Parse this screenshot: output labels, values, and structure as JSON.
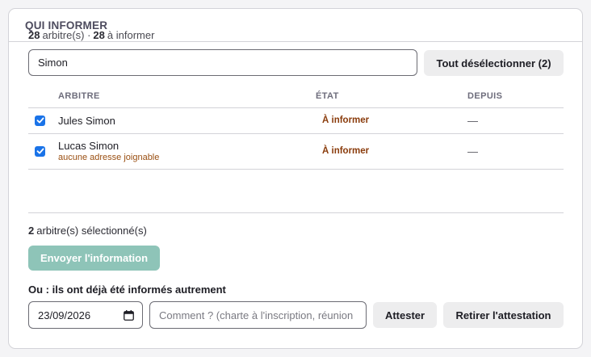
{
  "panel": {
    "title": "QUI INFORMER"
  },
  "counts": {
    "total": "28",
    "total_label": "arbitre(s) ·",
    "to_inform": "28",
    "to_inform_label": "à informer"
  },
  "search": {
    "value": "Simon",
    "deselect_label": "Tout désélectionner (2)"
  },
  "table": {
    "headers": [
      "ARBITRE",
      "ÉTAT",
      "DEPUIS"
    ],
    "rows": [
      {
        "checked": true,
        "name": "Jules Simon",
        "note": "",
        "state": "À informer",
        "since": "—"
      },
      {
        "checked": true,
        "name": "Lucas Simon",
        "note": "aucune adresse joignable",
        "state": "À informer",
        "since": "—"
      }
    ]
  },
  "selection": {
    "count": "2",
    "label": "arbitre(s) sélectionné(s)"
  },
  "send_label": "Envoyer l'information",
  "alternative": {
    "label": "Ou : ils ont déjà été informés autrement",
    "date": "23/09/2026",
    "comment_placeholder": "Comment ? (charte à l'inscription, réunion",
    "attest_label": "Attester",
    "remove_label": "Retirer l'attestation"
  },
  "colors": {
    "accent_send": "#8ec4b8",
    "state_text": "#8a3c0c",
    "checkbox": "#1a73e8"
  },
  "icons": [
    "checkbox-checked-icon",
    "calendar-icon"
  ]
}
